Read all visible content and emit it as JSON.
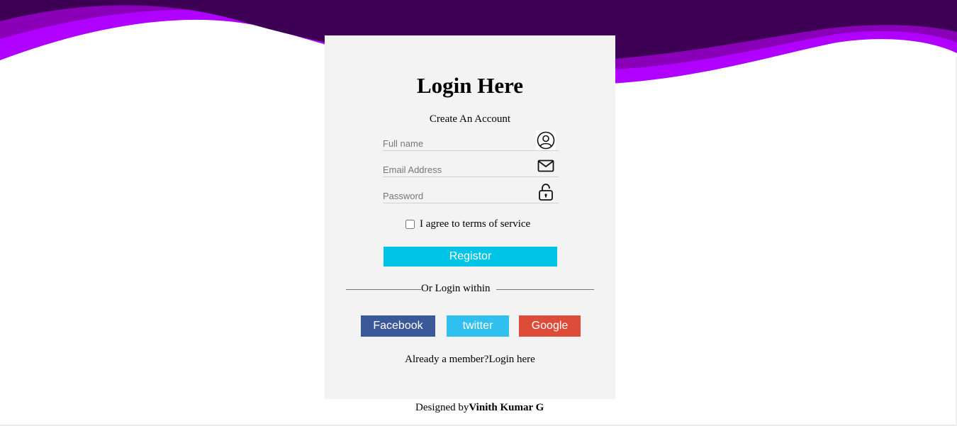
{
  "colors": {
    "wave_dark": "#3d0055",
    "wave_mid": "#8a00b8",
    "wave_bright": "#b000ff",
    "card_bg": "#f3f3f3",
    "register_bg": "#00c4e6",
    "facebook_bg": "#3b5998",
    "twitter_bg": "#2fc0f0",
    "google_bg": "#dd4b39"
  },
  "form": {
    "title": "Login Here",
    "subtitle": "Create An Account",
    "fields": {
      "full_name": {
        "placeholder": "Full name",
        "value": "",
        "icon": "user-circle-icon"
      },
      "email": {
        "placeholder": "Email Address",
        "value": "",
        "icon": "envelope-icon"
      },
      "password": {
        "placeholder": "Password",
        "value": "",
        "icon": "lock-icon"
      }
    },
    "terms_label": "I agree to terms of service",
    "terms_checked": false,
    "register_label": "Registor",
    "divider_label": "Or Login within",
    "social": {
      "facebook": "Facebook",
      "twitter": "twitter",
      "google": "Google"
    },
    "member_text": "Already a member?",
    "member_link": "Login here"
  },
  "footer": {
    "designed_by": "Designed by",
    "author": "Vinith Kumar G"
  }
}
